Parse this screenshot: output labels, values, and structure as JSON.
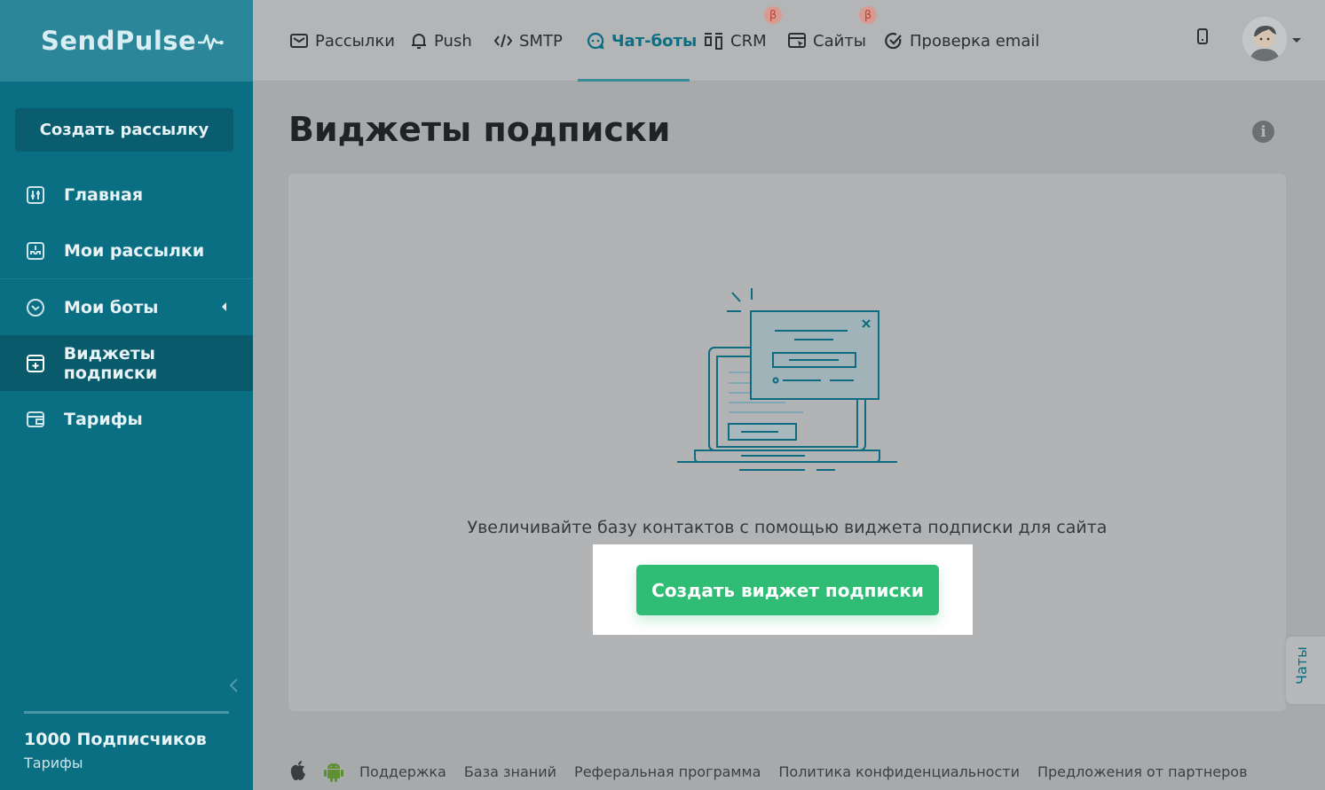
{
  "app": {
    "logo": "SendPulse"
  },
  "sidebar": {
    "create_button": "Создать рассылку",
    "items": [
      {
        "label": "Главная",
        "icon": "sliders-icon"
      },
      {
        "label": "Мои рассылки",
        "icon": "mailbox-icon"
      },
      {
        "label": "Мои боты",
        "icon": "bot-icon"
      },
      {
        "label": "Виджеты подписки",
        "icon": "widget-icon"
      },
      {
        "label": "Тарифы",
        "icon": "wallet-icon"
      }
    ],
    "subscribers": "1000 Подписчиков",
    "plans_link": "Тарифы"
  },
  "topnav": {
    "items": [
      {
        "label": "Рассылки",
        "icon": "envelope-icon"
      },
      {
        "label": "Push",
        "icon": "bell-icon"
      },
      {
        "label": "SMTP",
        "icon": "code-icon"
      },
      {
        "label": "Чат-боты",
        "icon": "chat-icon"
      },
      {
        "label": "CRM",
        "icon": "kanban-icon"
      },
      {
        "label": "Сайты",
        "icon": "browser-icon"
      },
      {
        "label": "Проверка email",
        "icon": "check-circle-icon"
      }
    ],
    "active": "Чат-боты",
    "beta_badge": "β"
  },
  "main": {
    "title": "Виджеты подписки",
    "hint": "Увеличивайте базу контактов с помощью виджета подписки для сайта",
    "cta": "Создать виджет подписки"
  },
  "chats_tab": "Чаты",
  "footer": {
    "links": [
      "Поддержка",
      "База знаний",
      "Реферальная программа",
      "Политика конфиденциальности",
      "Предложения от партнеров"
    ]
  },
  "colors": {
    "sidebar": "#0b6f84",
    "accent": "#2fbc74",
    "active_nav": "#0b6f84"
  }
}
